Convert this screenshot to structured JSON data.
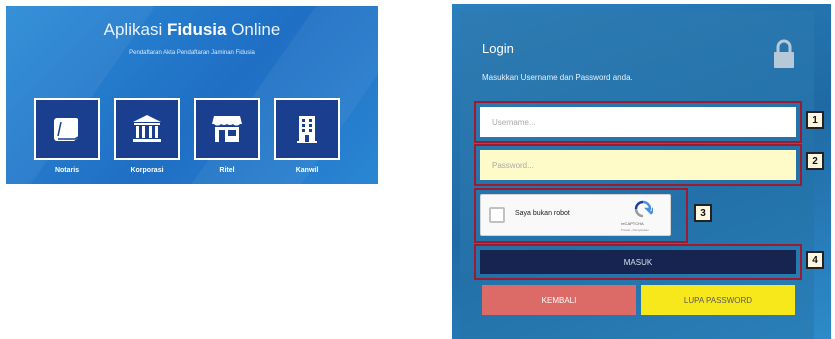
{
  "left": {
    "title_prefix": "Aplikasi ",
    "title_bold": "Fidusia",
    "title_suffix": " Online",
    "subtitle": "Pendaftaran Akta Pendaftaran Jaminan Fidusia",
    "tiles": [
      {
        "label": "Notaris",
        "icon": "book-icon"
      },
      {
        "label": "Korporasi",
        "icon": "bank-building-icon"
      },
      {
        "label": "Ritel",
        "icon": "storefront-icon"
      },
      {
        "label": "Kanwil",
        "icon": "office-building-icon"
      }
    ]
  },
  "login": {
    "title": "Login",
    "description": "Masukkan Username dan Password anda.",
    "username_placeholder": "Username...",
    "password_placeholder": "Password...",
    "captcha_label": "Saya bukan robot",
    "captcha_brand": "reCAPTCHA",
    "captcha_terms": "Privasi - Persyaratan",
    "submit_label": "MASUK",
    "back_label": "KEMBALI",
    "forgot_label": "LUPA PASSWORD"
  },
  "badges": [
    "1",
    "2",
    "3",
    "4"
  ],
  "colors": {
    "highlight_border": "#9e1b2e",
    "submit_bg": "#16244f",
    "back_bg": "#dc6a66",
    "forgot_bg": "#f6e81a",
    "password_bg": "#fffbc8"
  }
}
